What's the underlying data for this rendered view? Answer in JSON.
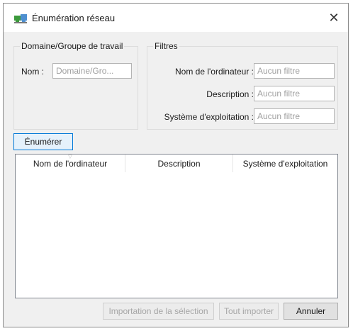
{
  "window": {
    "title": "Énumération réseau",
    "icon": "network-icon"
  },
  "domain_group": {
    "title": "Domaine/Groupe de travail",
    "name_label": "Nom :",
    "name_placeholder": "Domaine/Gro..."
  },
  "filters": {
    "title": "Filtres",
    "computer_label": "Nom de l'ordinateur :",
    "computer_placeholder": "Aucun filtre",
    "description_label": "Description :",
    "description_placeholder": "Aucun filtre",
    "os_label": "Système d'exploitation :",
    "os_placeholder": "Aucun filtre"
  },
  "enumerate_button": "Énumérer",
  "list": {
    "columns": [
      "Nom de l'ordinateur",
      "Description",
      "Système d'exploitation"
    ]
  },
  "footer": {
    "import_selection": "Importation de la sélection",
    "import_all": "Tout importer",
    "cancel": "Annuler"
  },
  "colors": {
    "accent": "#0078d7",
    "window_bg": "#f0f0f0",
    "icon_green": "#3c9a3c"
  }
}
